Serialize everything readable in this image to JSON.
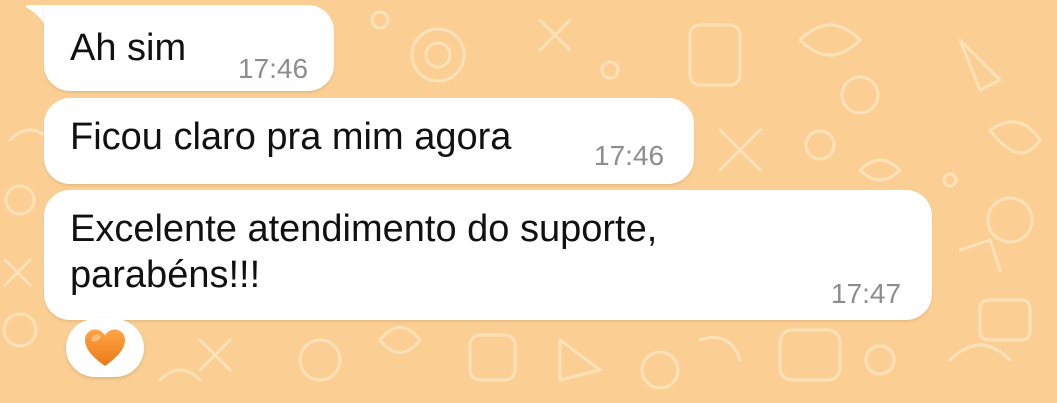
{
  "chat": {
    "background_color": "#fbcf94",
    "messages": [
      {
        "text": "Ah sim",
        "time": "17:46"
      },
      {
        "text": "Ficou claro pra mim agora",
        "time": "17:46"
      },
      {
        "text": "Excelente atendimento do suporte,\nparabéns!!!",
        "time": "17:47"
      }
    ],
    "reaction": {
      "icon": "orange-heart-icon",
      "color": "#f28c28"
    }
  }
}
